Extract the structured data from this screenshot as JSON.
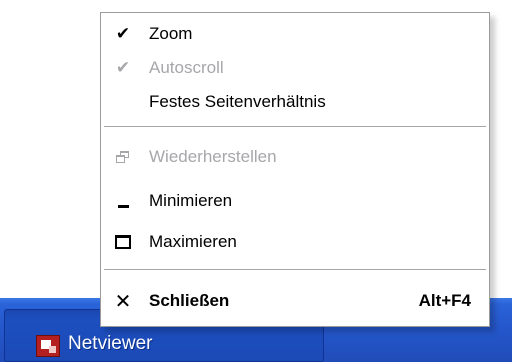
{
  "menu": {
    "items": [
      {
        "label": "Zoom",
        "icon": "checkmark-icon",
        "checked": true,
        "enabled": true
      },
      {
        "label": "Autoscroll",
        "icon": "checkmark-icon",
        "checked": true,
        "enabled": false
      },
      {
        "label": "Festes Seitenverhältnis",
        "icon": "",
        "checked": false,
        "enabled": true
      },
      {
        "label": "Wiederherstellen",
        "icon": "restore-window-icon",
        "enabled": false
      },
      {
        "label": "Minimieren",
        "icon": "minimize-window-icon",
        "enabled": true
      },
      {
        "label": "Maximieren",
        "icon": "maximize-window-icon",
        "enabled": true
      },
      {
        "label": "Schließen",
        "icon": "close-x-icon",
        "shortcut": "Alt+F4",
        "enabled": true,
        "bold": true
      }
    ],
    "glyphs": {
      "check": "✔",
      "close": "✕"
    }
  },
  "taskbar": {
    "active_window": {
      "label": "Netviewer",
      "icon": "netviewer-app-icon"
    }
  },
  "colors": {
    "taskbar_blue": "#2557cc",
    "disabled_text": "#a7a6aa",
    "menu_border": "#9b9b9b"
  }
}
